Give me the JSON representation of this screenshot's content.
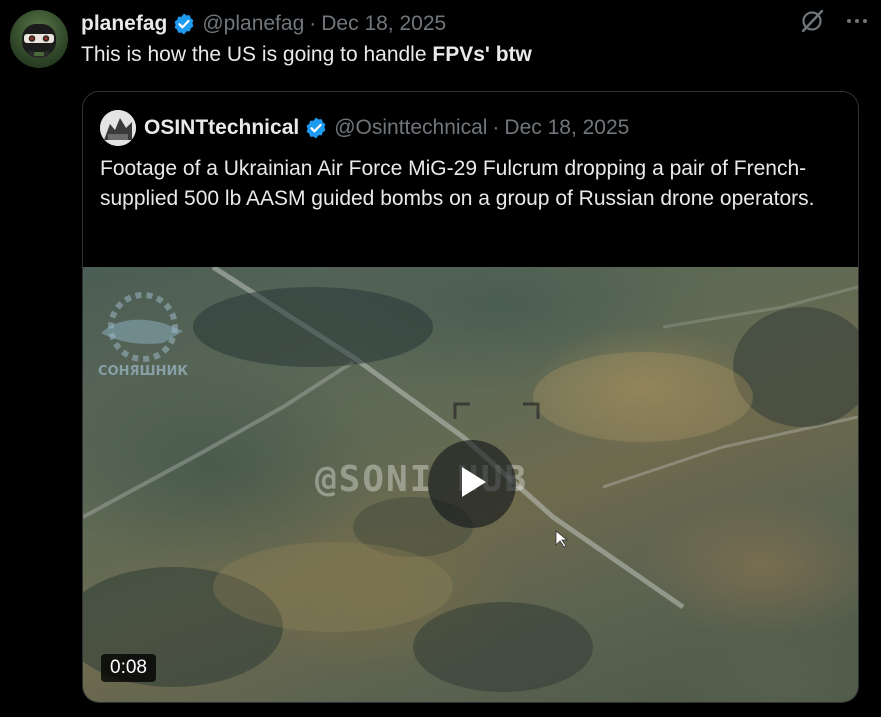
{
  "tweet": {
    "author_name": "planefag",
    "author_handle": "@planefag",
    "separator": "·",
    "date": "Dec 18, 2025",
    "text_prefix": "This is how the US is going to handle ",
    "text_bold": "FPVs' btw",
    "avatar_icon": "masked-face-avatar",
    "verified_icon": "verified-badge-icon",
    "verified_color": "#1d9bf0"
  },
  "quote": {
    "author_name": "OSINTtechnical",
    "author_handle": "@Osinttechnical",
    "separator": "·",
    "date": "Dec 18, 2025",
    "text": "Footage of a Ukrainian Air Force MiG-29 Fulcrum dropping a pair of French-supplied 500 lb AASM guided bombs on a group of Russian drone operators.",
    "avatar_icon": "osint-avatar"
  },
  "media": {
    "watermark_text": "@SONI    HUB",
    "logo_text": "СОНЯШНИК",
    "duration": "0:08",
    "play_icon": "play-icon"
  },
  "colors": {
    "background": "#000000",
    "text_primary": "#e7e9ea",
    "text_secondary": "#71767b",
    "border": "#2f3336"
  }
}
